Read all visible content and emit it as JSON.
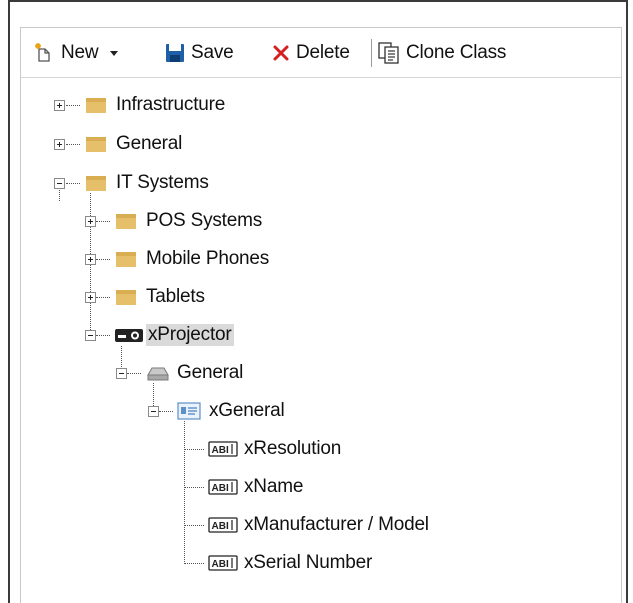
{
  "toolbar": {
    "new_label": "New",
    "save_label": "Save",
    "delete_label": "Delete",
    "clone_label": "Clone Class"
  },
  "tree": {
    "infrastructure": "Infrastructure",
    "general_root": "General",
    "it_systems": "IT Systems",
    "pos_systems": "POS Systems",
    "mobile_phones": "Mobile Phones",
    "tablets": "Tablets",
    "xprojector": "xProjector",
    "general_group": "General",
    "xgeneral": "xGeneral",
    "fields": [
      "xResolution",
      "xName",
      "xManufacturer / Model",
      "xSerial Number"
    ]
  },
  "colors": {
    "folder": "#e5bf6a",
    "save_blue": "#1f5fa8",
    "delete_red": "#d42020",
    "selection": "#dadada"
  }
}
